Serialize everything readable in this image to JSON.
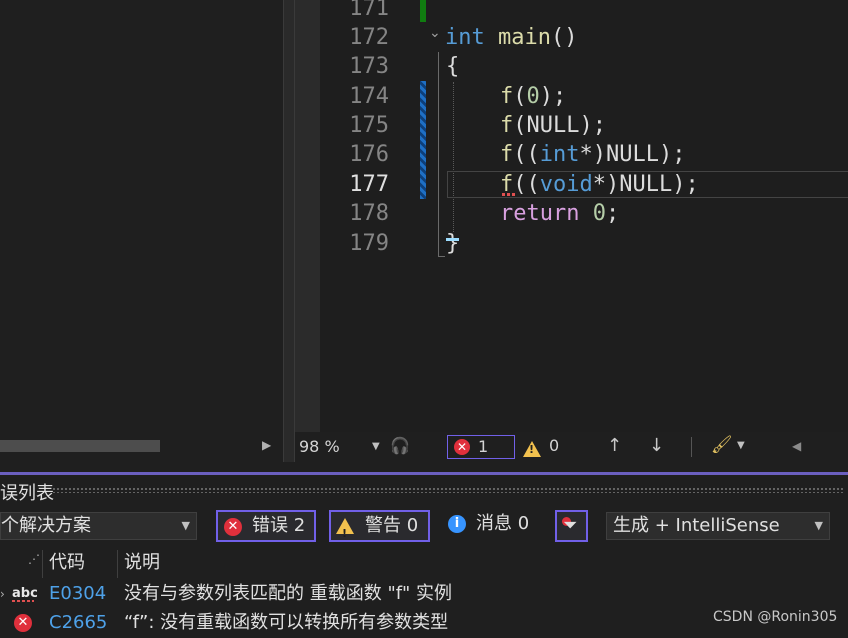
{
  "editor": {
    "lines": [
      {
        "num": "171",
        "current": false
      },
      {
        "num": "172",
        "current": false
      },
      {
        "num": "173",
        "current": false
      },
      {
        "num": "174",
        "current": false
      },
      {
        "num": "175",
        "current": false
      },
      {
        "num": "176",
        "current": false
      },
      {
        "num": "177",
        "current": true
      },
      {
        "num": "178",
        "current": false
      },
      {
        "num": "179",
        "current": false
      }
    ],
    "code": {
      "l172_kw": "int",
      "l172_fn": "main",
      "l172_rest": "()",
      "l173": "{",
      "f": "f",
      "l174_open": "(",
      "l174_num": "0",
      "l174_close": ");",
      "l175_rest": "(NULL);",
      "l176_open": "((",
      "l176_kw": "int",
      "l176_rest": "*)NULL);",
      "l177_kw": "void",
      "l178_kw": "return",
      "l178_num": "0",
      "l178_end": ";",
      "l179": "}"
    }
  },
  "editor_status": {
    "zoom": "98 %",
    "error_count": "1",
    "warning_count": "0"
  },
  "error_list": {
    "title": "误列表",
    "scope": "个解决方案",
    "errors_label": "错误 2",
    "warnings_label": "警告 0",
    "messages_label": "消息 0",
    "source": "生成 + IntelliSense",
    "columns": {
      "code": "代码",
      "description": "说明"
    },
    "rows": [
      {
        "icon": "abc",
        "code": "E0304",
        "description": "没有与参数列表匹配的 重载函数 \"f\" 实例"
      },
      {
        "icon": "error",
        "code": "C2665",
        "description": "“f”: 没有重载函数可以转换所有参数类型"
      }
    ]
  },
  "watermark": "CSDN @Ronin305",
  "colors": {
    "accent": "#7160e8",
    "error": "#e0303c",
    "warning": "#f2c14e",
    "info": "#3794ff",
    "keyword": "#569cd6",
    "control_keyword": "#d8a0df",
    "function": "#dcdcaa",
    "number": "#b5cea8"
  },
  "icons": [
    "chevron-down-icon",
    "intellicode-icon",
    "error-circle-icon",
    "warning-icon",
    "arrow-up-icon",
    "arrow-down-icon",
    "brush-icon",
    "info-icon",
    "filter-icon",
    "spell-abc-icon"
  ]
}
